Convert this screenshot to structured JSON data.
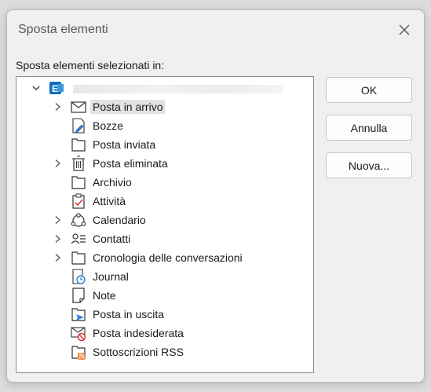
{
  "dialog": {
    "title": "Sposta elementi",
    "prompt": "Sposta elementi selezionati in:",
    "buttons": {
      "ok": "OK",
      "cancel": "Annulla",
      "new": "Nuova..."
    }
  },
  "tree": {
    "account": {
      "icon": "exchange-icon",
      "expanded": true
    },
    "folders": [
      {
        "label": "Posta in arrivo",
        "icon": "envelope-icon",
        "expandable": true,
        "selected": true
      },
      {
        "label": "Bozze",
        "icon": "drafts-icon",
        "expandable": false
      },
      {
        "label": "Posta inviata",
        "icon": "folder-icon",
        "expandable": false
      },
      {
        "label": "Posta eliminata",
        "icon": "trash-icon",
        "expandable": true
      },
      {
        "label": "Archivio",
        "icon": "folder-icon",
        "expandable": false
      },
      {
        "label": "Attività",
        "icon": "tasks-icon",
        "expandable": false
      },
      {
        "label": "Calendario",
        "icon": "calendar-icon",
        "expandable": true
      },
      {
        "label": "Contatti",
        "icon": "contacts-icon",
        "expandable": true
      },
      {
        "label": "Cronologia delle conversazioni",
        "icon": "folder-icon",
        "expandable": true
      },
      {
        "label": "Journal",
        "icon": "journal-icon",
        "expandable": false
      },
      {
        "label": "Note",
        "icon": "note-icon",
        "expandable": false
      },
      {
        "label": "Posta in uscita",
        "icon": "outbox-icon",
        "expandable": false
      },
      {
        "label": "Posta indesiderata",
        "icon": "junk-icon",
        "expandable": false
      },
      {
        "label": "Sottoscrizioni RSS",
        "icon": "rss-icon",
        "expandable": false
      }
    ]
  },
  "colors": {
    "exchange": "#0f6cbd",
    "check": "#d13438",
    "rss": "#f0883e",
    "outbox": "#2f7fd8",
    "junk": "#d13438",
    "journal": "#2f7fd8"
  }
}
